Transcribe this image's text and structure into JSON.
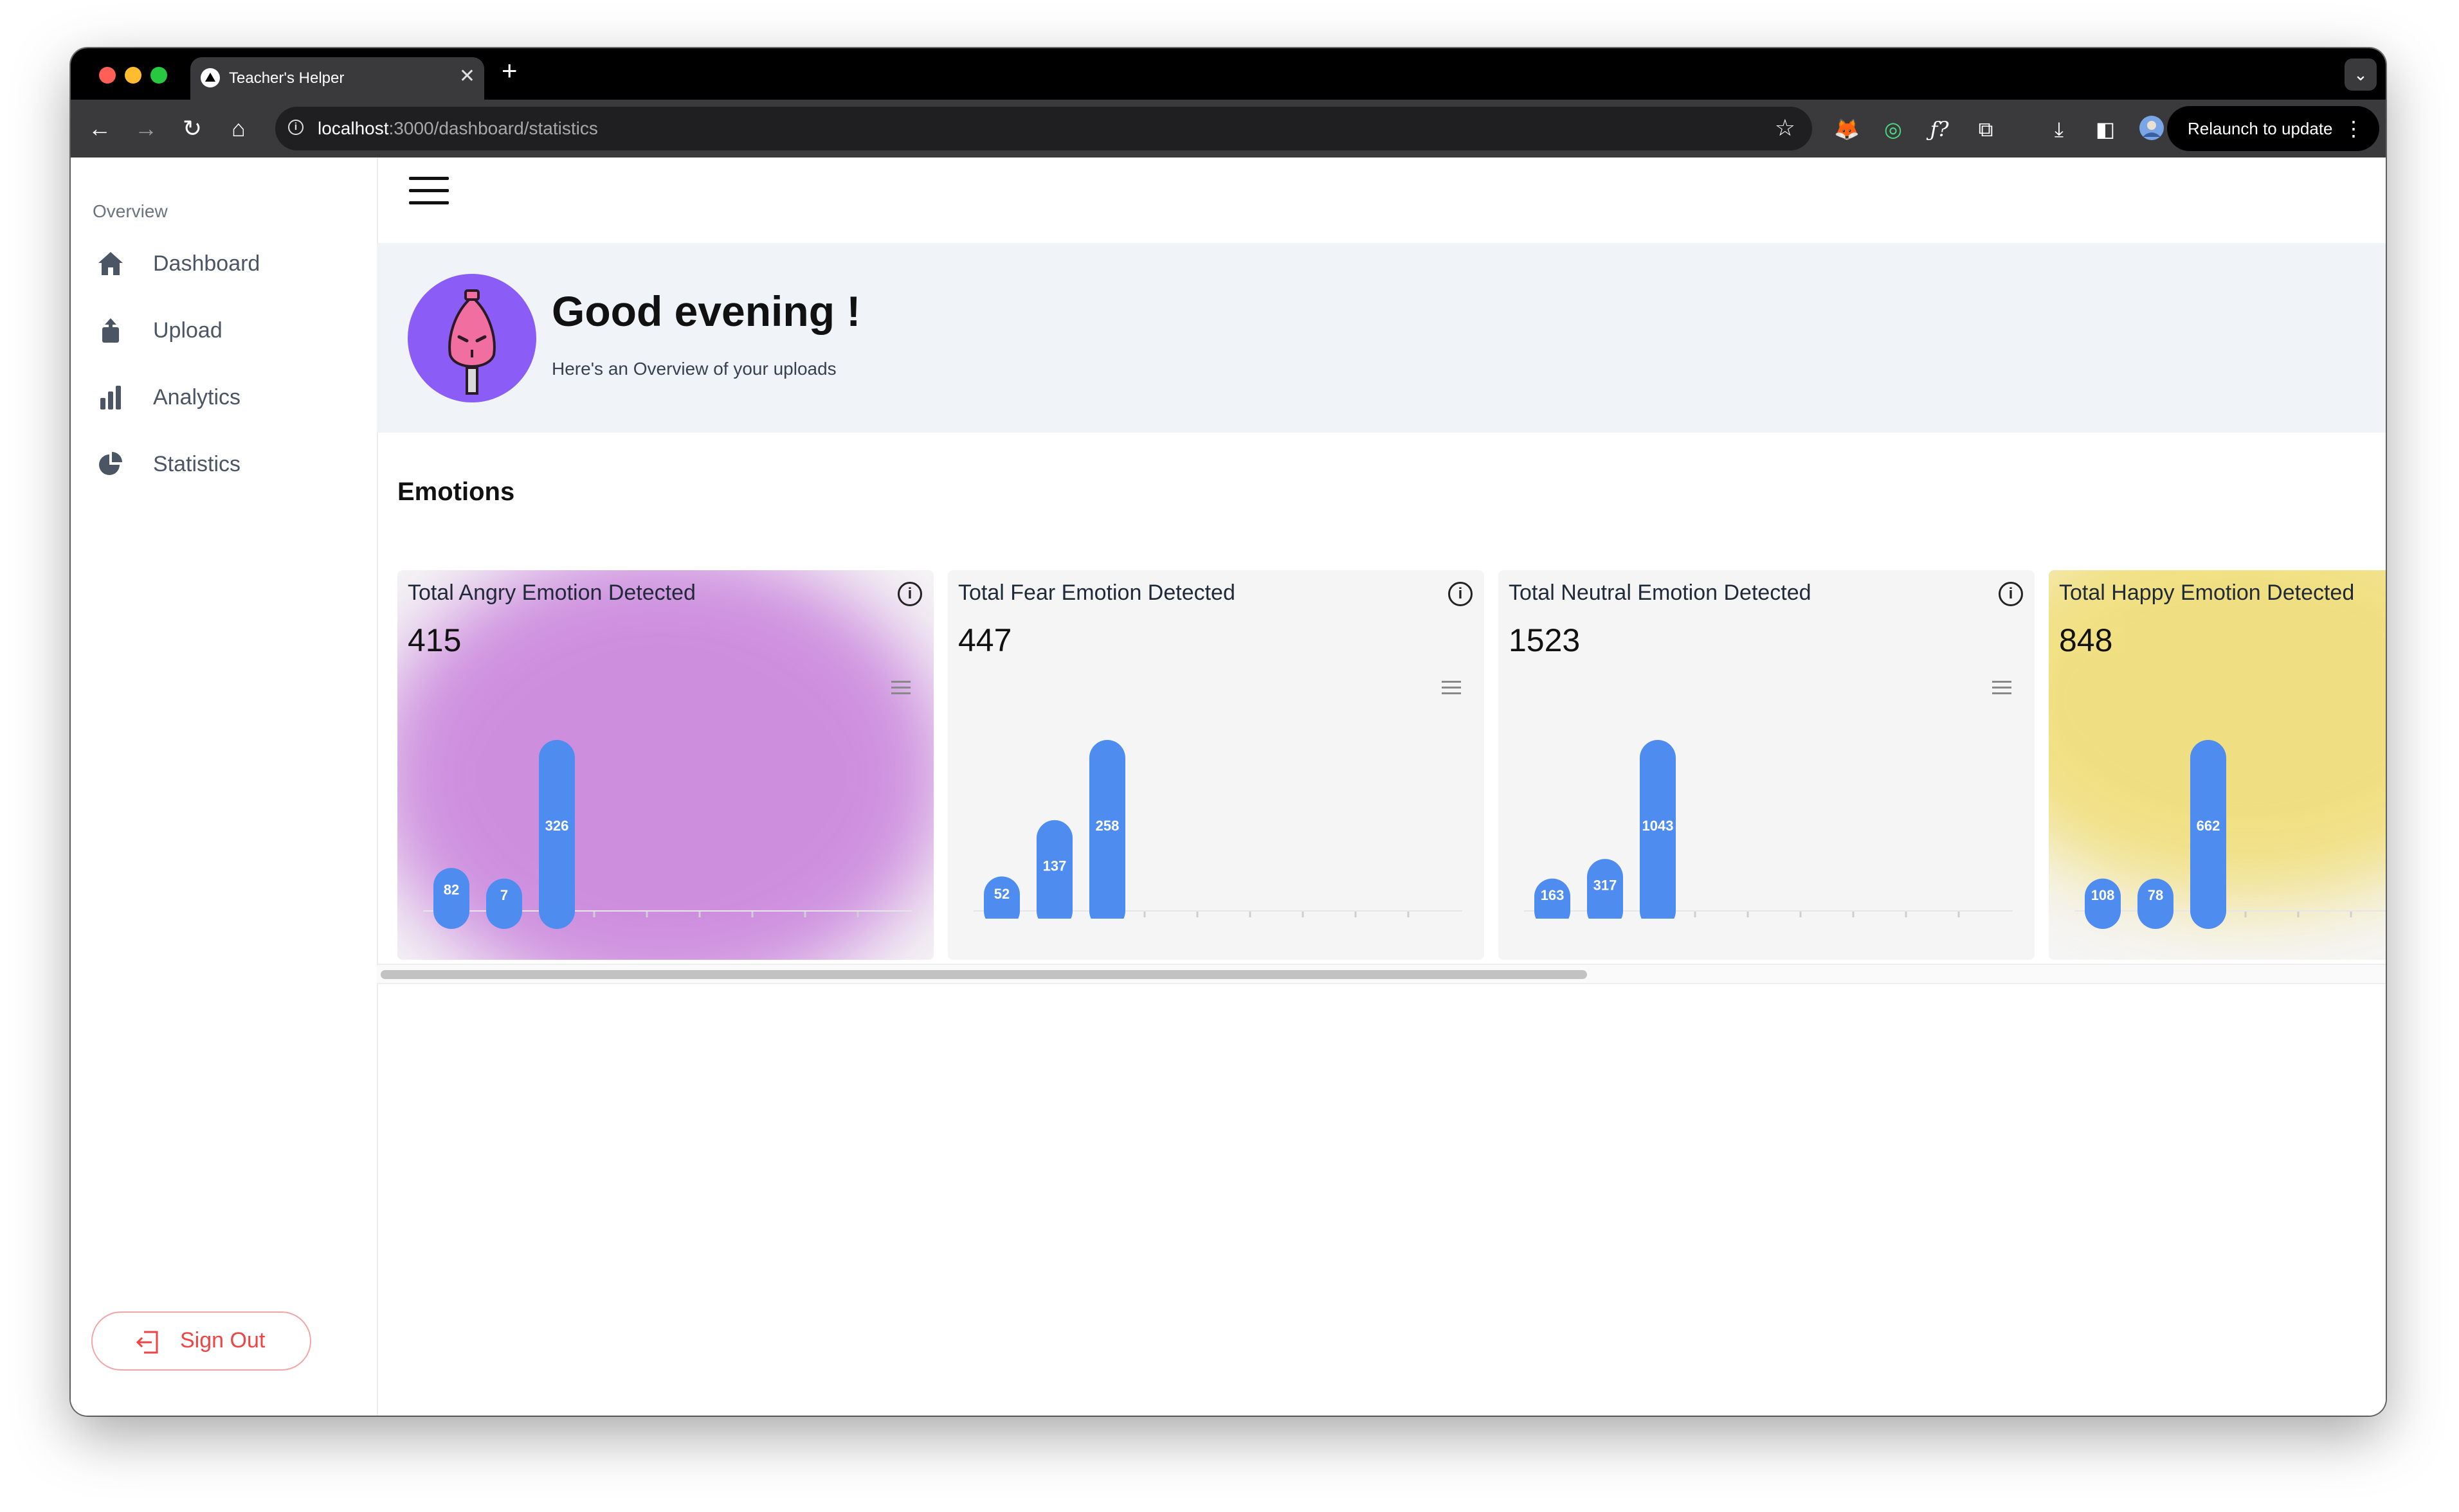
{
  "browser": {
    "tab_title": "Teacher's Helper",
    "url_host": "localhost",
    "url_path": ":3000/dashboard/statistics",
    "relaunch_label": "Relaunch to update"
  },
  "sidebar": {
    "section_label": "Overview",
    "items": [
      {
        "label": "Dashboard",
        "icon": "home-icon"
      },
      {
        "label": "Upload",
        "icon": "upload-icon"
      },
      {
        "label": "Analytics",
        "icon": "bar-chart-icon"
      },
      {
        "label": "Statistics",
        "icon": "pie-chart-icon"
      }
    ],
    "sign_out_label": "Sign Out"
  },
  "header": {
    "greeting": "Good evening !",
    "subtitle": "Here's an Overview of your uploads"
  },
  "emotions": {
    "title": "Emotions",
    "cards": [
      {
        "title": "Total Angry Emotion Detected",
        "total": "415",
        "values": [
          82,
          7,
          326
        ],
        "glow": "#c77ddb"
      },
      {
        "title": "Total Fear Emotion Detected",
        "total": "447",
        "values": [
          52,
          137,
          258
        ],
        "glow": ""
      },
      {
        "title": "Total Neutral Emotion Detected",
        "total": "1523",
        "values": [
          163,
          317,
          1043
        ],
        "glow": ""
      },
      {
        "title": "Total Happy Emotion Detected",
        "total": "848",
        "values": [
          108,
          78,
          662
        ],
        "glow": "#f0dc6e"
      }
    ]
  },
  "chart_data": [
    {
      "type": "bar",
      "title": "Total Angry Emotion Detected",
      "series": [
        {
          "values": [
            82,
            7,
            326
          ]
        }
      ]
    },
    {
      "type": "bar",
      "title": "Total Fear Emotion Detected",
      "series": [
        {
          "values": [
            52,
            137,
            258
          ]
        }
      ]
    },
    {
      "type": "bar",
      "title": "Total Neutral Emotion Detected",
      "series": [
        {
          "values": [
            163,
            317,
            1043
          ]
        }
      ]
    },
    {
      "type": "bar",
      "title": "Total Happy Emotion Detected",
      "series": [
        {
          "values": [
            108,
            78,
            662
          ]
        }
      ]
    }
  ],
  "colors": {
    "bar": "#4e8cf0",
    "accent": "#8b5cf6",
    "signout": "#ef4444"
  }
}
